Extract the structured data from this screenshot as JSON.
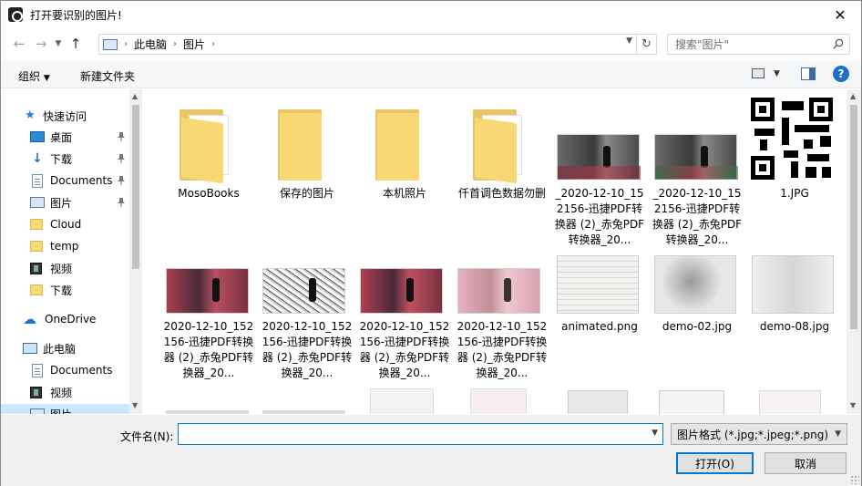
{
  "window": {
    "title": "打开要识别的图片!"
  },
  "address": {
    "crumbs": [
      "此电脑",
      "图片"
    ]
  },
  "search": {
    "placeholder": "搜索\"图片\""
  },
  "command_bar": {
    "organize": "组织",
    "new_folder": "新建文件夹"
  },
  "nav": {
    "quick_access": "快速访问",
    "items": [
      {
        "label": "桌面",
        "icon": "desktop-icon",
        "pinned": true
      },
      {
        "label": "下载",
        "icon": "download-icon",
        "pinned": true
      },
      {
        "label": "Documents",
        "icon": "document-icon",
        "pinned": true
      },
      {
        "label": "图片",
        "icon": "pictures-icon",
        "pinned": true
      },
      {
        "label": "Cloud",
        "icon": "folder-icon",
        "pinned": false
      },
      {
        "label": "temp",
        "icon": "folder-icon",
        "pinned": false
      },
      {
        "label": "视频",
        "icon": "video-icon",
        "pinned": false
      },
      {
        "label": "下载",
        "icon": "folder-icon",
        "pinned": false
      }
    ],
    "onedrive": "OneDrive",
    "this_pc": "此电脑",
    "pc_items": [
      {
        "label": "Documents",
        "icon": "document-icon"
      },
      {
        "label": "视频",
        "icon": "video-icon"
      },
      {
        "label": "图片",
        "icon": "pictures-icon"
      }
    ]
  },
  "files": {
    "row1": [
      {
        "name": "MosoBooks",
        "type": "folder"
      },
      {
        "name": "保存的图片",
        "type": "folder"
      },
      {
        "name": "本机照片",
        "type": "folder"
      },
      {
        "name": "仟首调色数据勿删",
        "type": "folder"
      },
      {
        "name": "_2020-12-10_152156-迅捷PDF转换器 (2)_赤兔PDF转换器_20...",
        "type": "image"
      },
      {
        "name": "_2020-12-10_152156-迅捷PDF转换器 (2)_赤兔PDF转换器_20...",
        "type": "image"
      },
      {
        "name": "1.JPG",
        "type": "qr"
      }
    ],
    "row2": [
      {
        "name": "2020-12-10_152156-迅捷PDF转换器 (2)_赤兔PDF转换器_20...",
        "type": "image"
      },
      {
        "name": "2020-12-10_152156-迅捷PDF转换器 (2)_赤兔PDF转换器_20...",
        "type": "image"
      },
      {
        "name": "2020-12-10_152156-迅捷PDF转换器 (2)_赤兔PDF转换器_20...",
        "type": "image"
      },
      {
        "name": "2020-12-10_152156-迅捷PDF转换器 (2)_赤兔PDF转换器_20...",
        "type": "image"
      },
      {
        "name": "animated.png",
        "type": "doc"
      },
      {
        "name": "demo-02.jpg",
        "type": "doc"
      },
      {
        "name": "demo-08.jpg",
        "type": "doc"
      }
    ]
  },
  "footer": {
    "filename_label": "文件名(N):",
    "filename_value": "",
    "filter": "图片格式 (*.jpg;*.jpeg;*.png)",
    "open": "打开(O)",
    "cancel": "取消"
  },
  "colors": {
    "accent": "#0078d7",
    "selection": "#cce8ff",
    "folder": "#f8d775"
  }
}
